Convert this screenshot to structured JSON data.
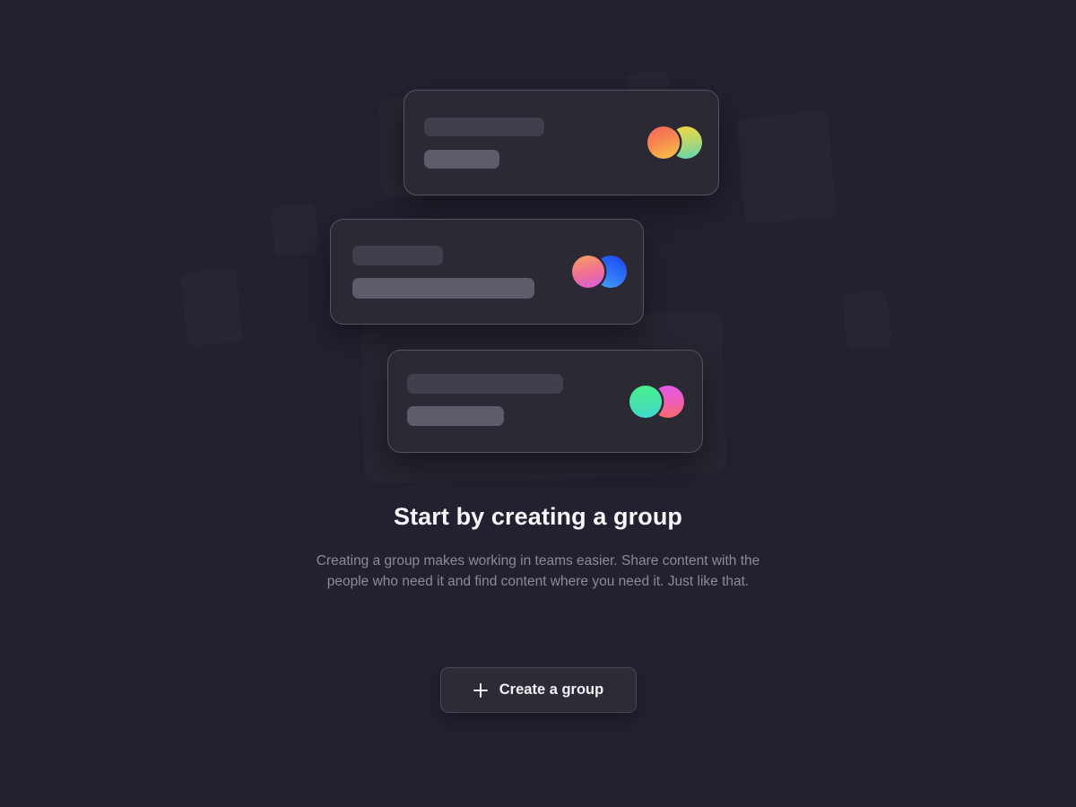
{
  "theme": {
    "background": "#232130",
    "card_background": "#2b2933",
    "card_border": "#56535f",
    "deco_shape": "#272532",
    "bar_dark": "#423f4d",
    "bar_light": "#5e5b6a",
    "heading_color": "#f7f6f8",
    "body_color": "#8d8a97",
    "button_background": "#2d2b36",
    "button_border": "#4a4753",
    "button_text": "#f3f2f5"
  },
  "empty_state": {
    "headline": "Start by creating a group",
    "description": "Creating a group makes working in teams easier. Share content with the people who need it and find content where you need it. Just like that.",
    "cta": {
      "label": "Create a group",
      "icon": "plus-icon"
    }
  },
  "illustration": {
    "cards": [
      {
        "id": "card-1",
        "avatars": [
          {
            "name": "avatar-orange-yellow",
            "from": "#f4605f",
            "to": "#fbc84a"
          },
          {
            "name": "avatar-yellow-teal",
            "from": "#f2d63f",
            "to": "#5fd6b2"
          }
        ]
      },
      {
        "id": "card-2",
        "avatars": [
          {
            "name": "avatar-orange-magenta",
            "from": "#f7a25d",
            "to": "#d65ce0"
          },
          {
            "name": "avatar-blue",
            "from": "#1f4ff2",
            "to": "#4aa7fb"
          }
        ]
      },
      {
        "id": "card-3",
        "avatars": [
          {
            "name": "avatar-green-teal",
            "from": "#48f08a",
            "to": "#3fd8d0"
          },
          {
            "name": "avatar-magenta-coral",
            "from": "#e459e8",
            "to": "#f96a6a"
          }
        ]
      }
    ],
    "decorative_shapes": 5,
    "ghost_cards": 2
  }
}
